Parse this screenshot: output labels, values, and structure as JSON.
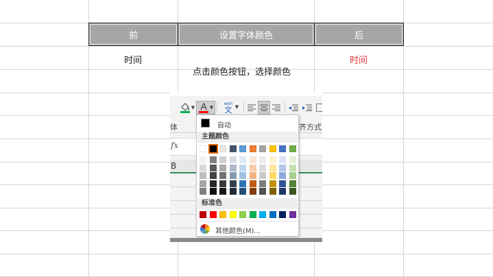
{
  "sheet": {
    "header_left": "前",
    "header_mid": "设置字体颜色",
    "header_right": "后",
    "cell_left": "时间",
    "cell_right": "时间",
    "cell_right_color": "#e03030",
    "instruction": "点击颜色按钮，选择颜色"
  },
  "ribbon": {
    "font_label_partial": "体",
    "align_label_partial": "齐方式",
    "fx": "fx",
    "column_b": "B",
    "fill_color": "#00b050",
    "font_color": "#ff0000",
    "phonetic_glyph": "wén文"
  },
  "palette": {
    "auto_label": "自动",
    "theme_section": "主题颜色",
    "standard_section": "标准色",
    "more_colors": "其他颜色(M)...",
    "theme_colors": [
      "#ffffff",
      "#000000",
      "#e7e6e6",
      "#44546a",
      "#5b9bd5",
      "#ed7d31",
      "#a5a5a5",
      "#ffc000",
      "#4472c4",
      "#70ad47"
    ],
    "shades": [
      [
        "#f2f2f2",
        "#d9d9d9",
        "#bfbfbf",
        "#a6a6a6",
        "#808080"
      ],
      [
        "#808080",
        "#595959",
        "#404040",
        "#262626",
        "#0d0d0d"
      ],
      [
        "#d0cece",
        "#aeaaaa",
        "#757171",
        "#3a3838",
        "#161616"
      ],
      [
        "#d6dce4",
        "#adb9ca",
        "#8497b0",
        "#333f4f",
        "#222a35"
      ],
      [
        "#deebf6",
        "#bdd7ee",
        "#9dc3e6",
        "#2e75b5",
        "#1f4e79"
      ],
      [
        "#fbe5d5",
        "#f7cbac",
        "#f4b183",
        "#c55a11",
        "#833c0b"
      ],
      [
        "#ededed",
        "#dbdbdb",
        "#c9c9c9",
        "#7b7b7b",
        "#525252"
      ],
      [
        "#fff2cc",
        "#fee599",
        "#ffd965",
        "#bf9000",
        "#7f6000"
      ],
      [
        "#dae3f3",
        "#b4c7e7",
        "#8faadc",
        "#2f5496",
        "#1f3864"
      ],
      [
        "#e2efd9",
        "#c5e0b3",
        "#a8d08d",
        "#538135",
        "#375623"
      ]
    ],
    "standard_colors": [
      "#c00000",
      "#ff0000",
      "#ffc000",
      "#ffff00",
      "#92d050",
      "#00b050",
      "#00b0f0",
      "#0070c0",
      "#002060",
      "#7030a0"
    ]
  }
}
